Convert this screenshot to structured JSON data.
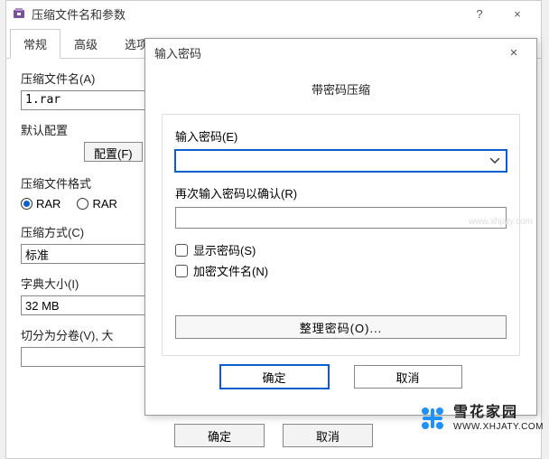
{
  "main": {
    "title": "压缩文件名和参数",
    "help": "?",
    "close": "×",
    "tabs": [
      "常规",
      "高级",
      "选项"
    ],
    "filename_label": "压缩文件名(A)",
    "filename_value": "1.rar",
    "default_label": "默认配置",
    "config_btn": "配置(F)",
    "format_label": "压缩文件格式",
    "fmt_rar": "RAR",
    "fmt_rar4": "RAR",
    "method_label": "压缩方式(C)",
    "method_value": "标准",
    "dict_label": "字典大小(I)",
    "dict_value": "32 MB",
    "split_label": "切分为分卷(V), 大",
    "ok": "确定",
    "cancel": "取消"
  },
  "pw": {
    "title": "输入密码",
    "close": "×",
    "heading": "带密码压缩",
    "pw1_label": "输入密码(E)",
    "pw2_label": "再次输入密码以确认(R)",
    "show_pw": "显示密码(S)",
    "encrypt_names": "加密文件名(N)",
    "organize": "整理密码(O)...",
    "ok": "确定",
    "cancel": "取消"
  },
  "watermark": {
    "cn": "雪花家园",
    "url": "WWW.XHJATY.COM",
    "mid": "www.xhjaty.com"
  }
}
